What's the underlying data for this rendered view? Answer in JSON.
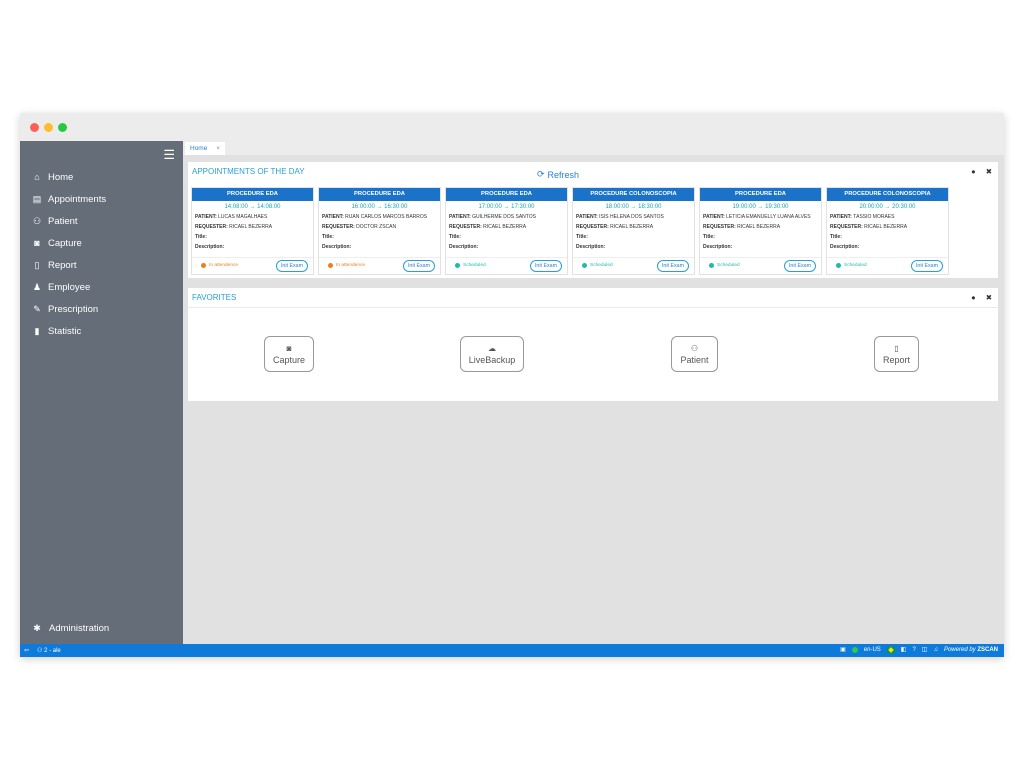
{
  "sidebar": {
    "items": [
      {
        "label": "Home",
        "icon": "home-icon"
      },
      {
        "label": "Appointments",
        "icon": "calendar-icon"
      },
      {
        "label": "Patient",
        "icon": "users-icon"
      },
      {
        "label": "Capture",
        "icon": "camera-icon"
      },
      {
        "label": "Report",
        "icon": "document-icon"
      },
      {
        "label": "Employee",
        "icon": "employee-icon"
      },
      {
        "label": "Prescription",
        "icon": "edit-icon"
      },
      {
        "label": "Statistic",
        "icon": "bar-chart-icon"
      }
    ],
    "admin_label": "Administration"
  },
  "tabs": [
    {
      "label": "Home",
      "close": "×"
    }
  ],
  "appointments": {
    "title": "APPOINTMENTS OF THE DAY",
    "refresh_label": "Refresh",
    "patient_prefix": "PATIENT:",
    "requester_prefix": "REQUESTER:",
    "title_prefix": "Title:",
    "description_prefix": "Description:",
    "init_label": "Init Exam",
    "status_colors": {
      "In attendence": "#f07c1c",
      "Scheduled": "#1bbcb0"
    },
    "cards": [
      {
        "procedure": "PROCEDURE EDA",
        "time": "14:08:00 → 14:08:00",
        "patient": "LUCAS MAGALHAES",
        "requester": "RICAEL BEZERRA",
        "status": "In attendence"
      },
      {
        "procedure": "PROCEDURE EDA",
        "time": "16:00:00 → 16:30:00",
        "patient": "RUAN CARLOS MARCOS BARROS",
        "requester": "DOCTOR ZSCAN",
        "status": "In attendence"
      },
      {
        "procedure": "PROCEDURE EDA",
        "time": "17:00:00 → 17:30:00",
        "patient": "GUILHERME DOS SANTOS",
        "requester": "RICAEL BEZERRA",
        "status": "Scheduled"
      },
      {
        "procedure": "PROCEDURE COLONOSCOPIA",
        "time": "18:00:00 → 18:30:00",
        "patient": "ISIS HELENA DOS SANTOS",
        "requester": "RICAEL BEZERRA",
        "status": "Scheduled"
      },
      {
        "procedure": "PROCEDURE EDA",
        "time": "19:00:00 → 19:30:00",
        "patient": "LETÍCIA EMANUELLY LUANA ALVES",
        "requester": "RICAEL BEZERRA",
        "status": "Scheduled"
      },
      {
        "procedure": "PROCEDURE COLONOSCOPIA",
        "time": "20:00:00 → 20:30:00",
        "patient": "TÁSSIO MORAES",
        "requester": "RICAEL BEZERRA",
        "status": "Scheduled"
      }
    ]
  },
  "favorites": {
    "title": "FAVORITES",
    "items": [
      {
        "label": "Capture",
        "icon": "camera-icon"
      },
      {
        "label": "LiveBackup",
        "icon": "cloud-upload-icon"
      },
      {
        "label": "Patient",
        "icon": "users-icon"
      },
      {
        "label": "Report",
        "icon": "document-icon"
      }
    ]
  },
  "statusbar": {
    "user": "2 - ale",
    "locale": "en-US",
    "powered_by": "Powered by",
    "brand": "ZSCAN"
  },
  "colors": {
    "sidebar_bg": "#656d78",
    "accent": "#1a73c8",
    "title_accent": "#2a9fd6",
    "statusbar_bg": "#0e7ad9"
  }
}
